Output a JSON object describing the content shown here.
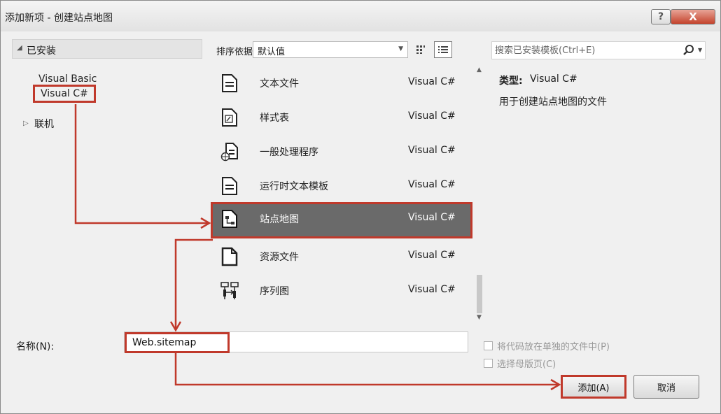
{
  "window": {
    "title": "添加新项 - 创建站点地图",
    "help_label": "?",
    "close_label": "X"
  },
  "left_pane": {
    "installed_label": "已安装",
    "items": [
      "Visual Basic",
      "Visual C#"
    ],
    "online_label": "联机"
  },
  "toolbar": {
    "sort_label": "排序依据:",
    "sort_value": "默认值"
  },
  "templates": [
    {
      "name": "文本文件",
      "lang": "Visual C#",
      "icon": "text-file-icon"
    },
    {
      "name": "样式表",
      "lang": "Visual C#",
      "icon": "stylesheet-icon"
    },
    {
      "name": "一般处理程序",
      "lang": "Visual C#",
      "icon": "generic-handler-icon"
    },
    {
      "name": "运行时文本模板",
      "lang": "Visual C#",
      "icon": "runtime-text-template-icon"
    },
    {
      "name": "站点地图",
      "lang": "Visual C#",
      "icon": "sitemap-icon",
      "selected": true
    },
    {
      "name": "资源文件",
      "lang": "Visual C#",
      "icon": "resource-file-icon"
    },
    {
      "name": "序列图",
      "lang": "Visual C#",
      "icon": "sequence-diagram-icon"
    }
  ],
  "search": {
    "placeholder": "搜索已安装模板(Ctrl+E)"
  },
  "details": {
    "type_label": "类型:",
    "type_value": "Visual C#",
    "description": "用于创建站点地图的文件"
  },
  "name_field": {
    "label": "名称(N):",
    "value": "Web.sitemap"
  },
  "options": {
    "code_separate": "将代码放在单独的文件中(P)",
    "master_page": "选择母版页(C)"
  },
  "buttons": {
    "add": "添加(A)",
    "cancel": "取消"
  },
  "colors": {
    "annotation": "#c0392b",
    "selected_row": "#6a6a6a"
  }
}
